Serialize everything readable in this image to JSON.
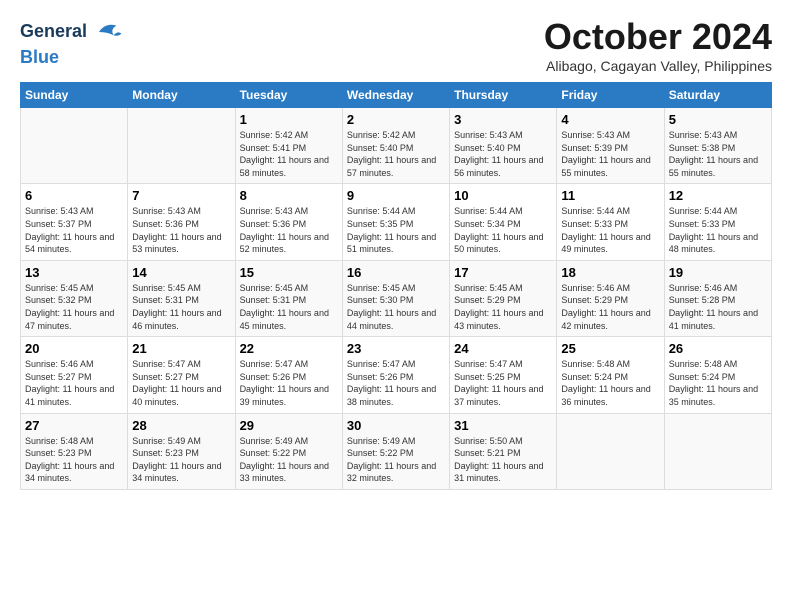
{
  "header": {
    "logo_line1": "General",
    "logo_line2": "Blue",
    "month_title": "October 2024",
    "subtitle": "Alibago, Cagayan Valley, Philippines"
  },
  "days_of_week": [
    "Sunday",
    "Monday",
    "Tuesday",
    "Wednesday",
    "Thursday",
    "Friday",
    "Saturday"
  ],
  "weeks": [
    [
      {
        "day": "",
        "detail": ""
      },
      {
        "day": "",
        "detail": ""
      },
      {
        "day": "1",
        "detail": "Sunrise: 5:42 AM\nSunset: 5:41 PM\nDaylight: 11 hours and 58 minutes."
      },
      {
        "day": "2",
        "detail": "Sunrise: 5:42 AM\nSunset: 5:40 PM\nDaylight: 11 hours and 57 minutes."
      },
      {
        "day": "3",
        "detail": "Sunrise: 5:43 AM\nSunset: 5:40 PM\nDaylight: 11 hours and 56 minutes."
      },
      {
        "day": "4",
        "detail": "Sunrise: 5:43 AM\nSunset: 5:39 PM\nDaylight: 11 hours and 55 minutes."
      },
      {
        "day": "5",
        "detail": "Sunrise: 5:43 AM\nSunset: 5:38 PM\nDaylight: 11 hours and 55 minutes."
      }
    ],
    [
      {
        "day": "6",
        "detail": "Sunrise: 5:43 AM\nSunset: 5:37 PM\nDaylight: 11 hours and 54 minutes."
      },
      {
        "day": "7",
        "detail": "Sunrise: 5:43 AM\nSunset: 5:36 PM\nDaylight: 11 hours and 53 minutes."
      },
      {
        "day": "8",
        "detail": "Sunrise: 5:43 AM\nSunset: 5:36 PM\nDaylight: 11 hours and 52 minutes."
      },
      {
        "day": "9",
        "detail": "Sunrise: 5:44 AM\nSunset: 5:35 PM\nDaylight: 11 hours and 51 minutes."
      },
      {
        "day": "10",
        "detail": "Sunrise: 5:44 AM\nSunset: 5:34 PM\nDaylight: 11 hours and 50 minutes."
      },
      {
        "day": "11",
        "detail": "Sunrise: 5:44 AM\nSunset: 5:33 PM\nDaylight: 11 hours and 49 minutes."
      },
      {
        "day": "12",
        "detail": "Sunrise: 5:44 AM\nSunset: 5:33 PM\nDaylight: 11 hours and 48 minutes."
      }
    ],
    [
      {
        "day": "13",
        "detail": "Sunrise: 5:45 AM\nSunset: 5:32 PM\nDaylight: 11 hours and 47 minutes."
      },
      {
        "day": "14",
        "detail": "Sunrise: 5:45 AM\nSunset: 5:31 PM\nDaylight: 11 hours and 46 minutes."
      },
      {
        "day": "15",
        "detail": "Sunrise: 5:45 AM\nSunset: 5:31 PM\nDaylight: 11 hours and 45 minutes."
      },
      {
        "day": "16",
        "detail": "Sunrise: 5:45 AM\nSunset: 5:30 PM\nDaylight: 11 hours and 44 minutes."
      },
      {
        "day": "17",
        "detail": "Sunrise: 5:45 AM\nSunset: 5:29 PM\nDaylight: 11 hours and 43 minutes."
      },
      {
        "day": "18",
        "detail": "Sunrise: 5:46 AM\nSunset: 5:29 PM\nDaylight: 11 hours and 42 minutes."
      },
      {
        "day": "19",
        "detail": "Sunrise: 5:46 AM\nSunset: 5:28 PM\nDaylight: 11 hours and 41 minutes."
      }
    ],
    [
      {
        "day": "20",
        "detail": "Sunrise: 5:46 AM\nSunset: 5:27 PM\nDaylight: 11 hours and 41 minutes."
      },
      {
        "day": "21",
        "detail": "Sunrise: 5:47 AM\nSunset: 5:27 PM\nDaylight: 11 hours and 40 minutes."
      },
      {
        "day": "22",
        "detail": "Sunrise: 5:47 AM\nSunset: 5:26 PM\nDaylight: 11 hours and 39 minutes."
      },
      {
        "day": "23",
        "detail": "Sunrise: 5:47 AM\nSunset: 5:26 PM\nDaylight: 11 hours and 38 minutes."
      },
      {
        "day": "24",
        "detail": "Sunrise: 5:47 AM\nSunset: 5:25 PM\nDaylight: 11 hours and 37 minutes."
      },
      {
        "day": "25",
        "detail": "Sunrise: 5:48 AM\nSunset: 5:24 PM\nDaylight: 11 hours and 36 minutes."
      },
      {
        "day": "26",
        "detail": "Sunrise: 5:48 AM\nSunset: 5:24 PM\nDaylight: 11 hours and 35 minutes."
      }
    ],
    [
      {
        "day": "27",
        "detail": "Sunrise: 5:48 AM\nSunset: 5:23 PM\nDaylight: 11 hours and 34 minutes."
      },
      {
        "day": "28",
        "detail": "Sunrise: 5:49 AM\nSunset: 5:23 PM\nDaylight: 11 hours and 34 minutes."
      },
      {
        "day": "29",
        "detail": "Sunrise: 5:49 AM\nSunset: 5:22 PM\nDaylight: 11 hours and 33 minutes."
      },
      {
        "day": "30",
        "detail": "Sunrise: 5:49 AM\nSunset: 5:22 PM\nDaylight: 11 hours and 32 minutes."
      },
      {
        "day": "31",
        "detail": "Sunrise: 5:50 AM\nSunset: 5:21 PM\nDaylight: 11 hours and 31 minutes."
      },
      {
        "day": "",
        "detail": ""
      },
      {
        "day": "",
        "detail": ""
      }
    ]
  ]
}
